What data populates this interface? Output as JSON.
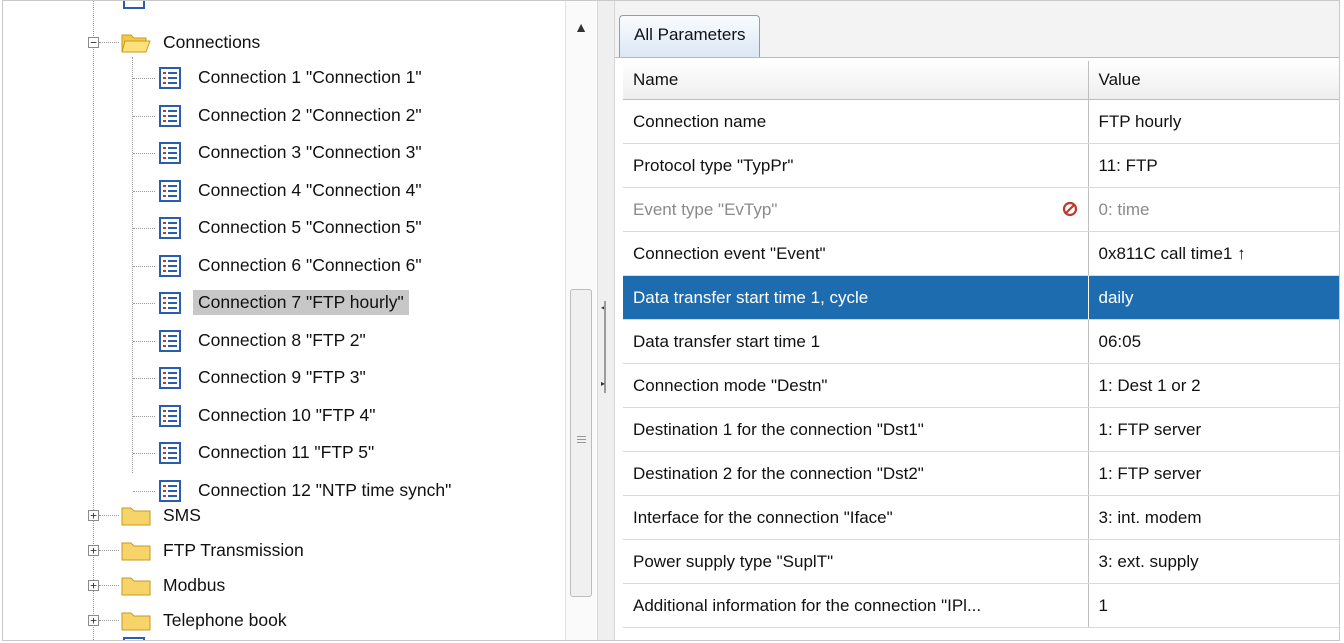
{
  "tree": {
    "connections_label": "Connections",
    "connection_items": [
      "Connection 1 \"Connection 1\"",
      "Connection 2 \"Connection 2\"",
      "Connection 3 \"Connection 3\"",
      "Connection 4 \"Connection 4\"",
      "Connection 5 \"Connection 5\"",
      "Connection 6 \"Connection 6\"",
      "Connection 7 \"FTP hourly\"",
      "Connection 8 \"FTP 2\"",
      "Connection 9 \"FTP 3\"",
      "Connection 10 \"FTP 4\"",
      "Connection 11 \"FTP 5\"",
      "Connection 12 \"NTP time synch\""
    ],
    "selected_item": "Connection 7 \"FTP hourly\"",
    "folders": [
      "SMS",
      "FTP Transmission",
      "Modbus",
      "Telephone book"
    ]
  },
  "tabs": {
    "active": "All Parameters"
  },
  "grid": {
    "header": {
      "name": "Name",
      "value": "Value"
    },
    "rows": [
      {
        "name": "Connection name",
        "value": "FTP hourly"
      },
      {
        "name": "Protocol type \"TypPr\"",
        "value": "11: FTP"
      },
      {
        "name": "Event type \"EvTyp\"",
        "value": "0: time"
      },
      {
        "name": "Connection event \"Event\"",
        "value": "0x811C call time1 ↑"
      },
      {
        "name": "Data transfer start time 1, cycle",
        "value": "daily"
      },
      {
        "name": "Data transfer start time 1",
        "value": "06:05"
      },
      {
        "name": "Connection mode \"Destn\"",
        "value": "1: Dest 1 or 2"
      },
      {
        "name": "Destination 1 for the connection \"Dst1\"",
        "value": "1: FTP server"
      },
      {
        "name": "Destination 2 for the connection \"Dst2\"",
        "value": "1: FTP server"
      },
      {
        "name": "Interface for the connection \"Iface\"",
        "value": "3: int. modem"
      },
      {
        "name": "Power supply type \"SuplT\"",
        "value": "3: ext. supply"
      },
      {
        "name": "Additional information for the connection \"IPl...",
        "value": "1"
      }
    ]
  },
  "colors": {
    "selection": "#1d6cb0",
    "tree_selection": "#c7c7c7"
  },
  "icons": [
    "folder-icon",
    "parameter-list-icon",
    "expand-icon",
    "collapse-icon",
    "blocked-icon"
  ]
}
